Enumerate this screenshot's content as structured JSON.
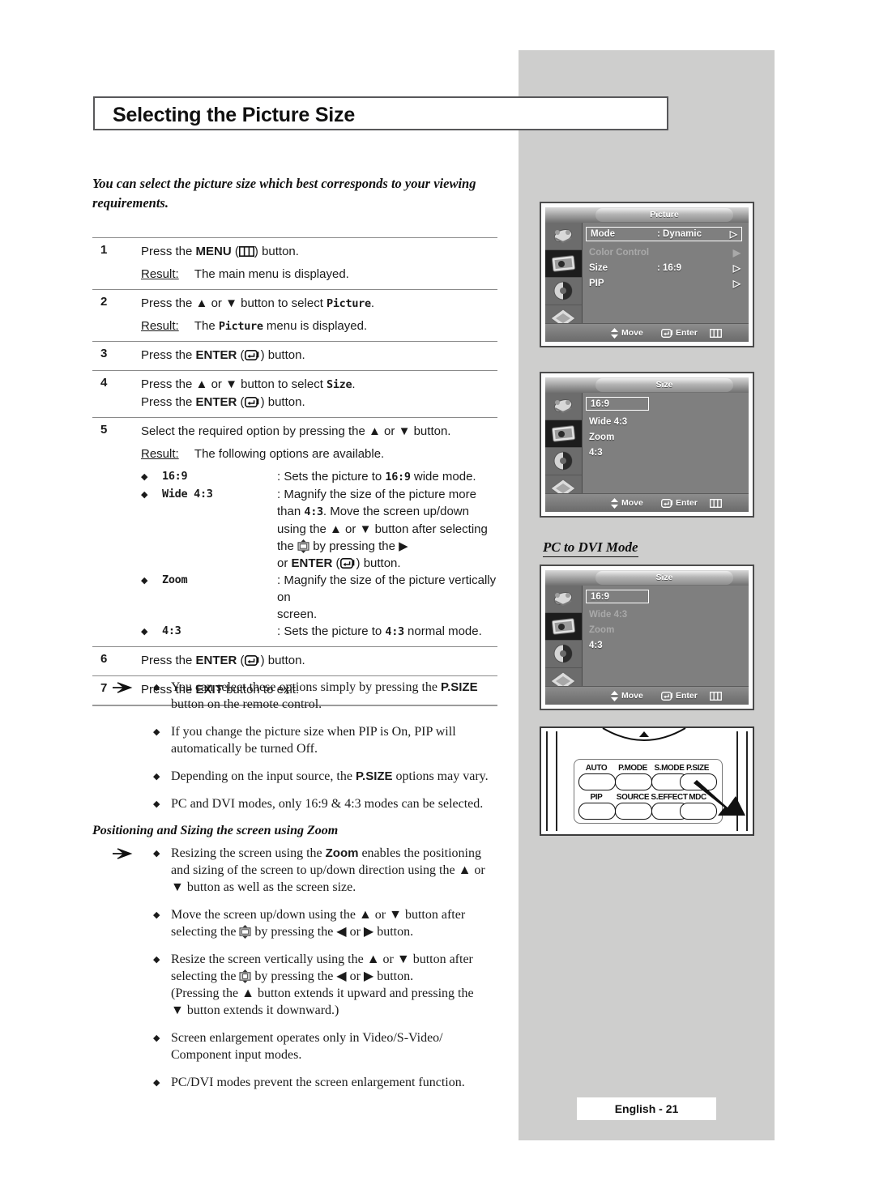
{
  "page": {
    "title": "Selecting the Picture Size",
    "intro": "You can select the picture size which best corresponds to your viewing requirements.",
    "footer": "English - 21"
  },
  "steps": [
    {
      "num": "1",
      "lines": [
        "Press the MENU (▤) button."
      ],
      "result_label": "Result:",
      "result": "The main menu is displayed."
    },
    {
      "num": "2",
      "lines": [
        "Press the ▲ or ▼ button to select Picture."
      ],
      "result_label": "Result:",
      "result": "The Picture menu is displayed."
    },
    {
      "num": "3",
      "lines": [
        "Press the ENTER (↵) button."
      ],
      "result_label": "",
      "result": ""
    },
    {
      "num": "4",
      "lines": [
        "Press the ▲ or ▼ button to select Size.",
        "Press the ENTER (↵) button."
      ],
      "result_label": "",
      "result": ""
    },
    {
      "num": "5",
      "lines": [
        "Select the required option by pressing the ▲ or ▼ button."
      ],
      "result_label": "Result:",
      "result": "The following options are available."
    },
    {
      "num": "6",
      "lines": [
        "Press the ENTER (↵) button."
      ],
      "result_label": "",
      "result": ""
    },
    {
      "num": "7",
      "lines": [
        "Press the EXIT button to exit."
      ],
      "result_label": "",
      "result": ""
    }
  ],
  "step_labels": {
    "press_the": "Press the",
    "menu": "MENU",
    "enter": "ENTER",
    "exit": "EXIT",
    "button": "button.",
    "button_to_select": "button to select",
    "or": "or",
    "to_exit": "button to exit.",
    "select_required": "Select the required option by pressing the",
    "picture": "Picture",
    "size": "Size"
  },
  "options": [
    {
      "bullet": "◆",
      "label": "16:9",
      "desc": ": Sets the picture to 16:9 wide mode."
    },
    {
      "bullet": "◆",
      "label": "Wide 4:3",
      "desc": ": Magnify the size of the picture more than 4:3. Move the screen up/down using the ▲ or ▼ button after selecting the ▣ by pressing the ▶ or ENTER (↵) button."
    },
    {
      "bullet": "◆",
      "label": "Zoom",
      "desc": ": Magnify the size of the picture vertically on screen."
    },
    {
      "bullet": "◆",
      "label": "4:3",
      "desc": ": Sets the picture to 4:3 normal mode."
    }
  ],
  "notes_top": [
    "You can select these options simply by pressing the P.SIZE button on the remote control.",
    "If you change the picture size when PIP is On, PIP will automatically be turned Off.",
    "Depending on the input source, the P.SIZE options may vary.",
    "PC and DVI modes, only 16:9 & 4:3 modes can be selected."
  ],
  "zoom_section": {
    "heading": "Positioning and Sizing the screen using Zoom",
    "notes": [
      "Resizing the screen using the Zoom enables the positioning and sizing of the screen to up/down direction using the ▲ or ▼ button as well as the screen size.",
      "Move the screen up/down using the ▲ or ▼ button after selecting the ▣ by pressing the ◀ or ▶ button.",
      "Resize the screen vertically using the ▲ or ▼ button after selecting the ▣ by pressing the ◀ or ▶ button. (Pressing the ▲ button extends it upward and pressing the ▼ button extends it downward.)",
      "Screen enlargement operates only in Video/S-Video/ Component input modes.",
      "PC/DVI modes prevent the screen enlargement function."
    ]
  },
  "osd": {
    "picture_menu": {
      "title": "Picture",
      "rows": [
        {
          "name": "Mode",
          "value": ": Dynamic",
          "arrow": "▷",
          "dim": false,
          "boxed": true
        },
        {
          "name": "Color Control",
          "value": "",
          "arrow": "▶",
          "dim": true,
          "boxed": false
        },
        {
          "name": "Size",
          "value": ": 16:9",
          "arrow": "▷",
          "dim": false,
          "boxed": false
        },
        {
          "name": "PIP",
          "value": "",
          "arrow": "▷",
          "dim": false,
          "boxed": false
        }
      ],
      "footer": {
        "move": "Move",
        "enter": "Enter",
        "return": "Return"
      }
    },
    "size_menu": {
      "title": "Size",
      "rows": [
        {
          "name": "16:9",
          "selected": true,
          "dim": false
        },
        {
          "name": "Wide 4:3",
          "selected": false,
          "dim": false
        },
        {
          "name": "Zoom",
          "selected": false,
          "dim": false
        },
        {
          "name": "4:3",
          "selected": false,
          "dim": false
        }
      ],
      "footer": {
        "move": "Move",
        "enter": "Enter",
        "return": "Return"
      }
    },
    "pc_dvi_heading": "PC to DVI Mode",
    "size_menu_dvi": {
      "title": "Size",
      "rows": [
        {
          "name": "16:9",
          "selected": true,
          "dim": false
        },
        {
          "name": "Wide 4:3",
          "selected": false,
          "dim": true
        },
        {
          "name": "Zoom",
          "selected": false,
          "dim": true
        },
        {
          "name": "4:3",
          "selected": false,
          "dim": false
        }
      ],
      "footer": {
        "move": "Move",
        "enter": "Enter",
        "return": "Return"
      }
    },
    "sidebar_icons": [
      "input-icon",
      "picture-icon",
      "sound-icon",
      "channel-icon",
      "setup-icon"
    ]
  },
  "remote": {
    "buttons_row1": [
      "AUTO",
      "P.MODE",
      "S.MODE",
      "P.SIZE"
    ],
    "buttons_row2": [
      "PIP",
      "SOURCE",
      "S.EFFECT",
      "MDC"
    ]
  }
}
